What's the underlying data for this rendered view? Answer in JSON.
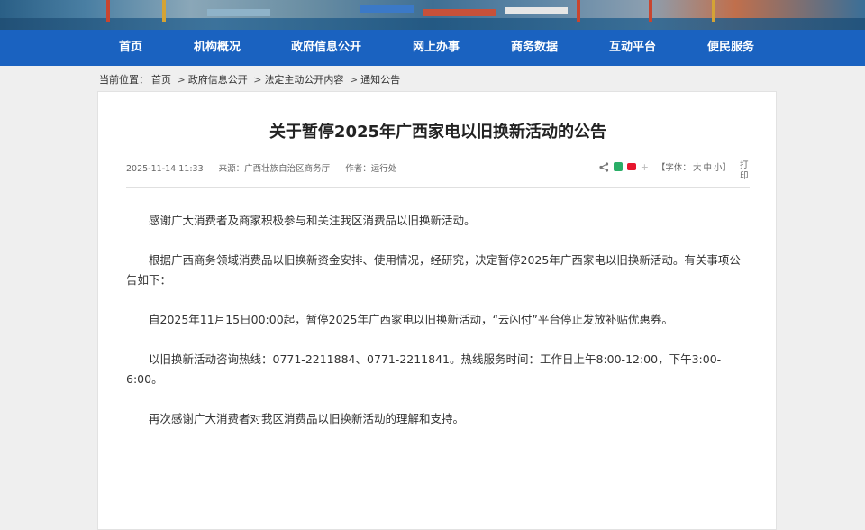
{
  "nav": {
    "items": [
      {
        "label": "首页"
      },
      {
        "label": "机构概况"
      },
      {
        "label": "政府信息公开"
      },
      {
        "label": "网上办事"
      },
      {
        "label": "商务数据"
      },
      {
        "label": "互动平台"
      },
      {
        "label": "便民服务"
      }
    ]
  },
  "breadcrumb": {
    "prefix": "当前位置：",
    "items": [
      "首页",
      "政府信息公开",
      "法定主动公开内容",
      "通知公告"
    ],
    "separator": ">"
  },
  "article": {
    "title": "关于暂停2025年广西家电以旧换新活动的公告",
    "date": "2025-11-14 11:33",
    "source": "来源：广西壮族自治区商务厅",
    "author": "作者：运行处",
    "font_label_open": "【字体：",
    "font_sizes": [
      "大",
      "中",
      "小"
    ],
    "font_label_close": "】",
    "print_label": "打印",
    "paragraphs": [
      "感谢广大消费者及商家积极参与和关注我区消费品以旧换新活动。",
      "根据广西商务领域消费品以旧换新资金安排、使用情况，经研究，决定暂停2025年广西家电以旧换新活动。有关事项公告如下：",
      "自2025年11月15日00:00起，暂停2025年广西家电以旧换新活动，“云闪付”平台停止发放补贴优惠券。",
      "以旧换新活动咨询热线：0771-2211884、0771-2211841。热线服务时间：工作日上午8:00-12:00，下午3:00-6:00。",
      "再次感谢广大消费者对我区消费品以旧换新活动的理解和支持。"
    ]
  },
  "colors": {
    "nav_bg": "#1a62c0",
    "page_bg": "#efefef",
    "card_bg": "#ffffff",
    "wechat": "#2aae67",
    "weibo": "#e6162d"
  },
  "icons": {
    "share": "share-icon",
    "wechat": "wechat-icon",
    "weibo": "weibo-icon",
    "more": "plus-icon"
  }
}
